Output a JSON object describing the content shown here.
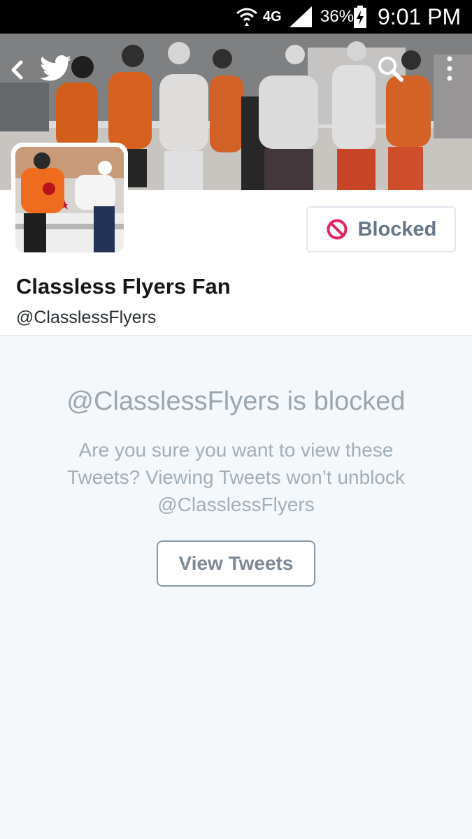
{
  "status_bar": {
    "network": "4G",
    "battery": "36%",
    "time": "9:01 PM"
  },
  "header": {
    "icons": [
      "back-icon",
      "twitter-bird-icon",
      "search-icon",
      "more-vertical-icon"
    ]
  },
  "profile": {
    "name": "Classless Flyers Fan",
    "handle": "@ClasslessFlyers",
    "blocked_label": "Blocked"
  },
  "blocked_notice": {
    "title": "@ClasslessFlyers is blocked",
    "description": "Are you sure you want to view these Tweets? Viewing Tweets won’t unblock @ClasslessFlyers",
    "view_button": "View Tweets"
  },
  "colors": {
    "background": "#f5f8fa",
    "blocked_icon": "#e0245e",
    "muted_text": "#9aa6b0"
  }
}
